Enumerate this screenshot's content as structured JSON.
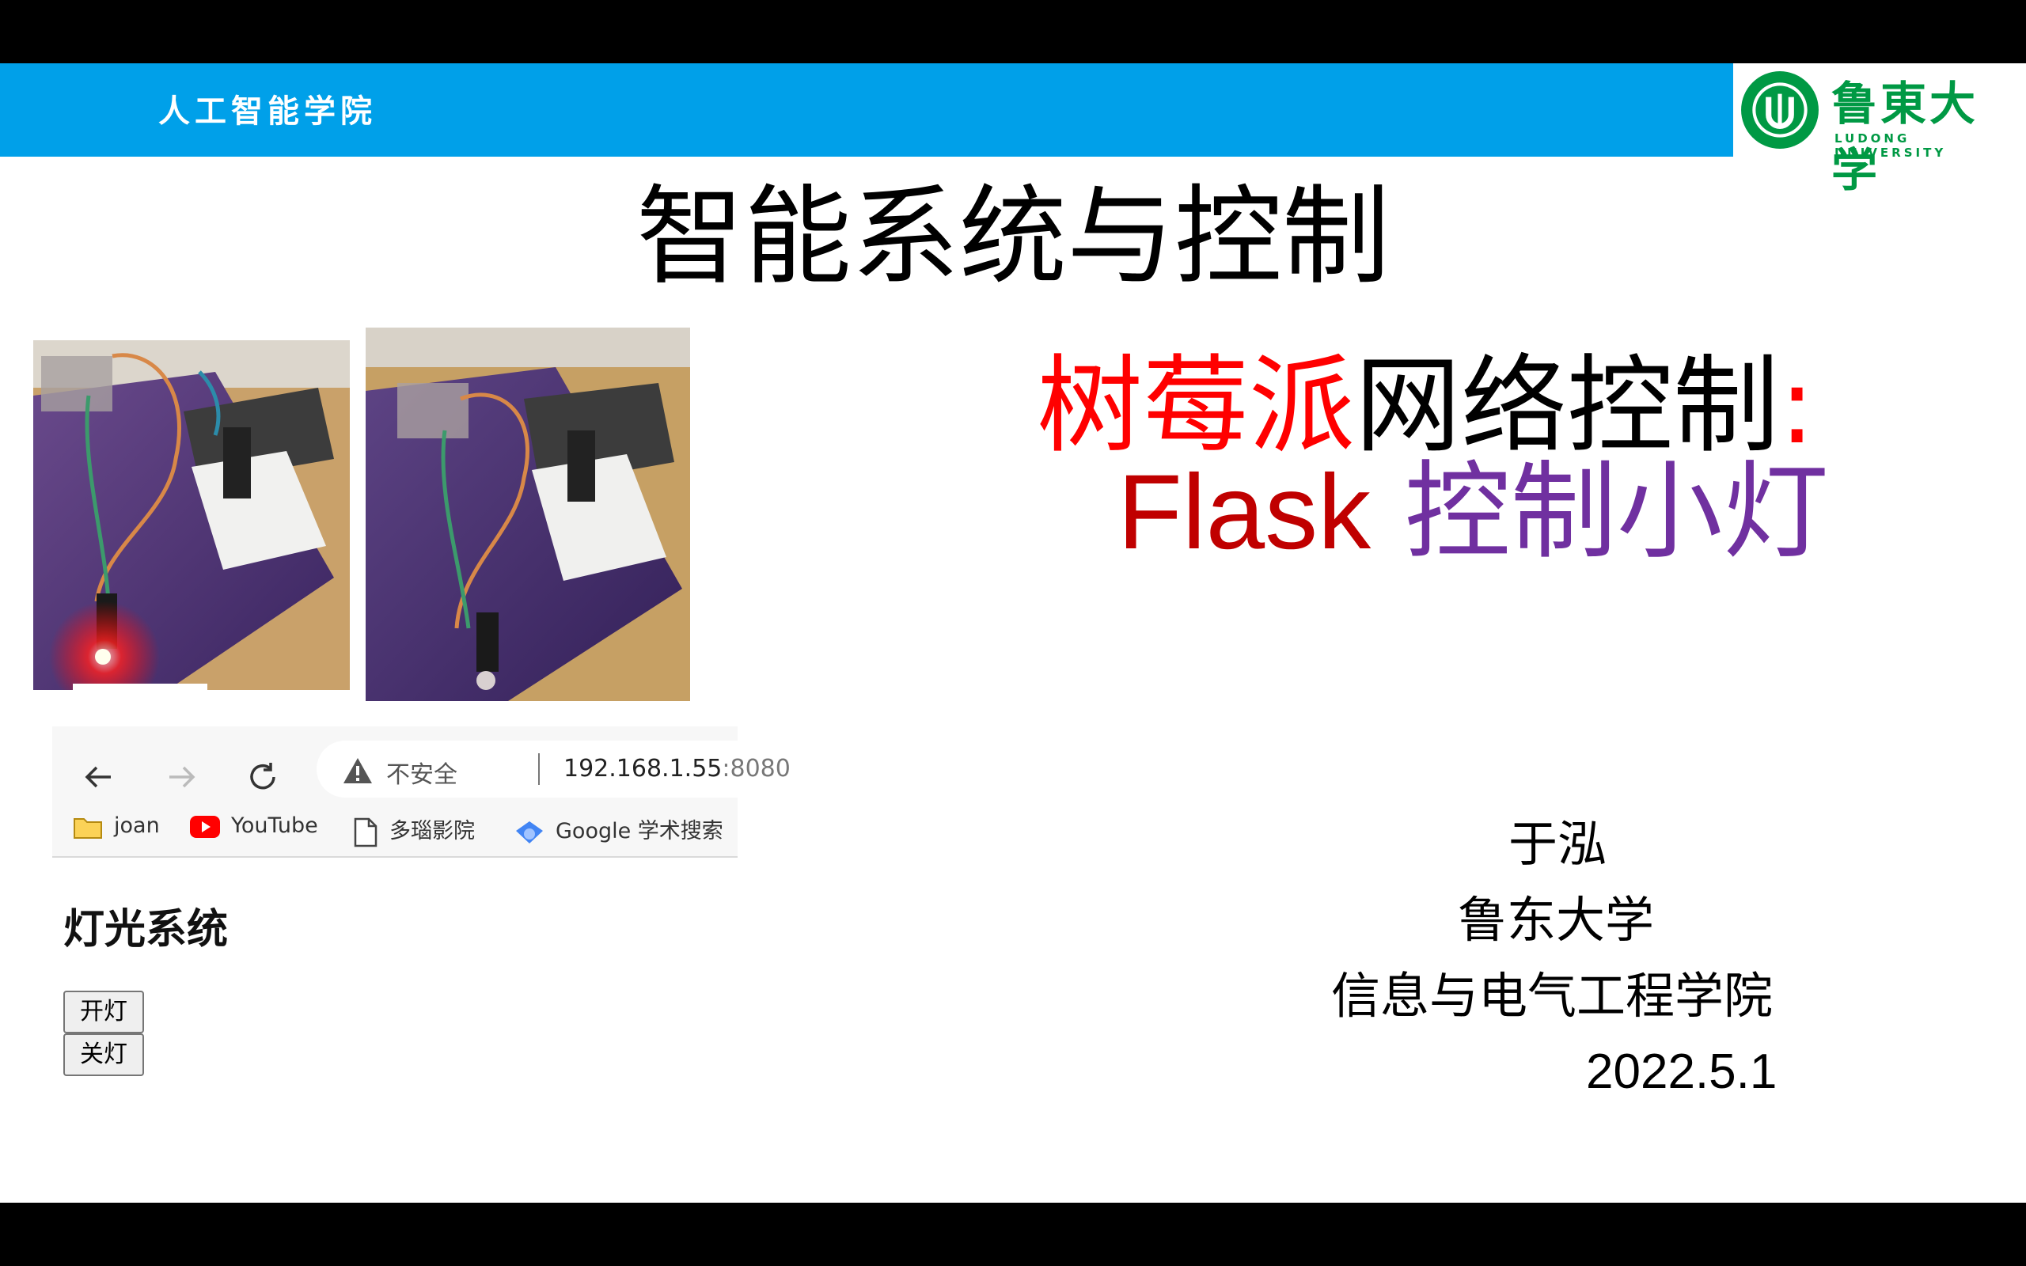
{
  "banner": {
    "title": "人工智能学院",
    "logo_cn": "鲁東大学",
    "logo_en": "LUDONG UNIVERSITY"
  },
  "slide": {
    "title": "智能系统与控制",
    "subtitle_line1": {
      "red": "树莓派",
      "black": "网络控制",
      "colon": ":"
    },
    "subtitle_line2": {
      "flask": "Flask",
      "purple": "控制小灯"
    },
    "author": {
      "name": "于泓",
      "university": "鲁东大学",
      "school": "信息与电气工程学院",
      "date": "2022.5.1"
    }
  },
  "browser": {
    "insecure_label": "不安全",
    "url_host": "192.168.1.55",
    "url_port": ":8080",
    "bookmarks": [
      {
        "label": "joan",
        "icon": "folder-icon"
      },
      {
        "label": "YouTube",
        "icon": "youtube-icon"
      },
      {
        "label": "多瑙影院",
        "icon": "page-icon"
      },
      {
        "label": "Google 学术搜索",
        "icon": "scholar-icon"
      }
    ]
  },
  "web_page": {
    "heading": "灯光系统",
    "on_button": "开灯",
    "off_button": "关灯"
  },
  "colors": {
    "banner": "#00a0e9",
    "red": "#ff0000",
    "dark_red": "#c00000",
    "purple": "#7030a0",
    "logo_green": "#009944"
  }
}
